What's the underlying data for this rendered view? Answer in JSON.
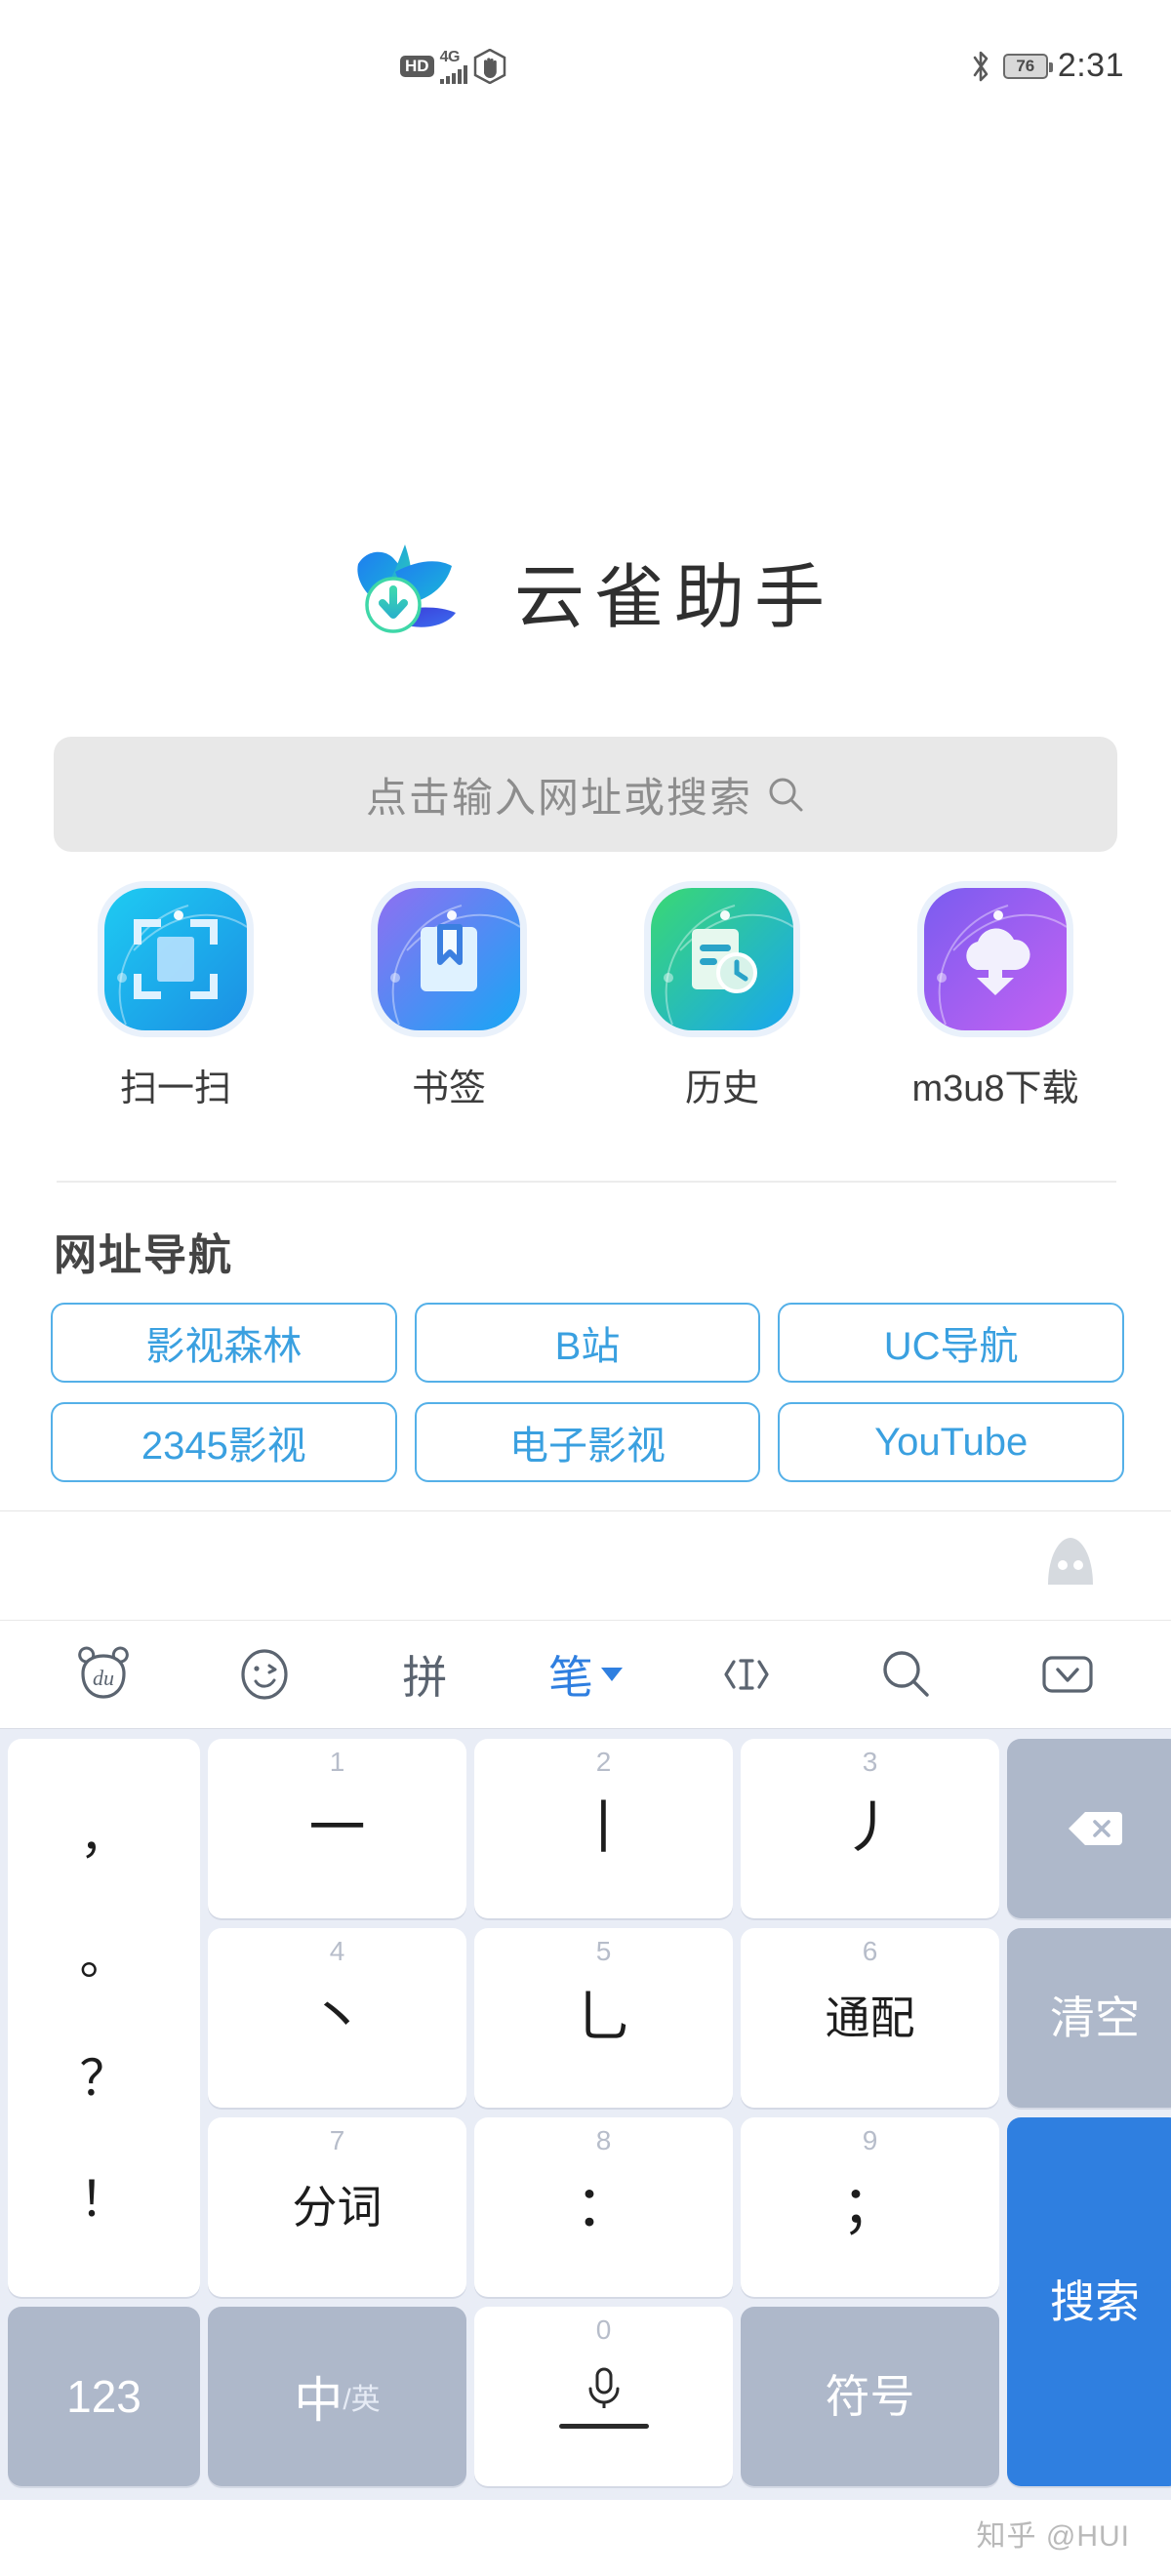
{
  "status_bar": {
    "hd_label": "HD",
    "network_label": "4G",
    "time": "2:31",
    "battery_level": "76",
    "icons": [
      "hd-badge",
      "signal-bars-icon",
      "do-not-disturb-icon",
      "bluetooth-icon",
      "battery-icon"
    ]
  },
  "brand": {
    "title": "云雀助手",
    "logo_icon": "lark-bird-download-logo"
  },
  "search": {
    "placeholder": "点击输入网址或搜索",
    "icon": "search-icon"
  },
  "shortcuts": [
    {
      "label": "扫一扫",
      "icon": "scan-icon",
      "color_from": "#1ec8f0",
      "color_to": "#1ea0e8"
    },
    {
      "label": "书签",
      "icon": "bookmark-icon",
      "color_from": "#8c6ef0",
      "color_to": "#18a6f5"
    },
    {
      "label": "历史",
      "icon": "history-icon",
      "color_from": "#38d870",
      "color_to": "#18a6f0"
    },
    {
      "label": "m3u8下载",
      "icon": "cloud-download-icon",
      "color_from": "#7a5cf0",
      "color_to": "#c060f0"
    }
  ],
  "nav": {
    "heading": "网址导航",
    "accent_color": "#3aa0e0",
    "links": [
      "影视森林",
      "B站",
      "UC导航",
      "2345影视",
      "电子影视",
      "YouTube"
    ]
  },
  "keyboard": {
    "toolbar": [
      {
        "name": "baidu-bear-icon",
        "label": "du",
        "type": "icon",
        "active": false
      },
      {
        "name": "emoji-icon",
        "label": "",
        "type": "icon",
        "active": false
      },
      {
        "name": "pinyin-mode",
        "label": "拼",
        "type": "text",
        "active": false
      },
      {
        "name": "stroke-mode",
        "label": "笔",
        "type": "text",
        "active": true
      },
      {
        "name": "cursor-move-icon",
        "label": "",
        "type": "icon",
        "active": false
      },
      {
        "name": "search-icon",
        "label": "",
        "type": "icon",
        "active": false
      },
      {
        "name": "hide-keyboard-icon",
        "label": "",
        "type": "icon",
        "active": false
      }
    ],
    "keys": {
      "punct_comma": "，",
      "punct_period": "。",
      "punct_question": "？",
      "punct_exclaim": "！",
      "n1": "1",
      "k1": "一",
      "n2": "2",
      "k2": "丨",
      "n3": "3",
      "k3": "丿",
      "n4": "4",
      "k4": "丶",
      "n5": "5",
      "k5": "乚",
      "n6": "6",
      "k6": "通配",
      "n7": "7",
      "k7": "分词",
      "n8": "8",
      "k8": "：",
      "n9": "9",
      "k9": "；",
      "n0": "0",
      "backspace": "backspace-icon",
      "clear": "清空",
      "search": "搜索",
      "numeric": "123",
      "lang_zh": "中",
      "lang_en": "/英",
      "mic": "mic-icon",
      "symbols": "符号"
    }
  },
  "watermark": "知乎 @HUI"
}
